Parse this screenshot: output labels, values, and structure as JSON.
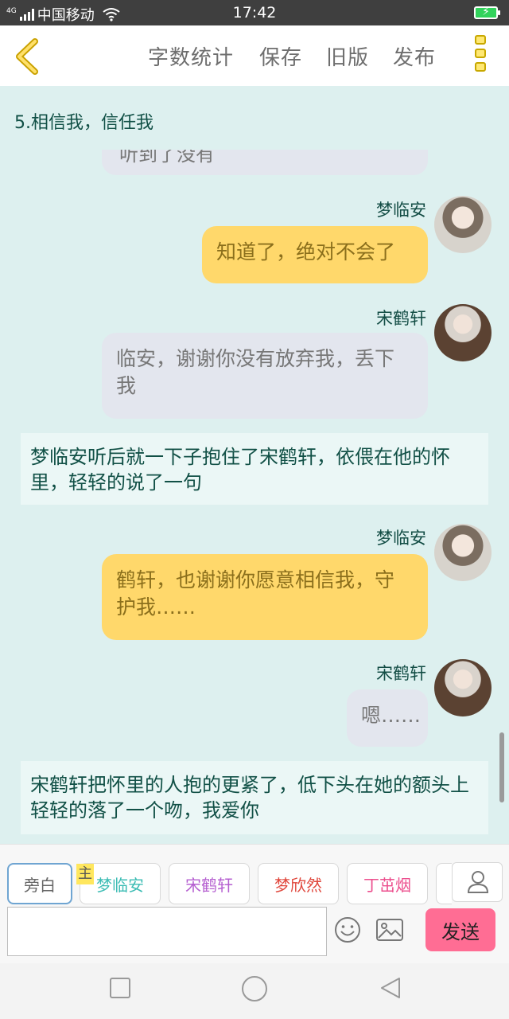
{
  "status": {
    "carrier": "中国移动",
    "network": "4G",
    "time": "17:42"
  },
  "header": {
    "back_icon": "chevron-left-icon",
    "buttons": [
      "字数统计",
      "保存",
      "旧版",
      "发布"
    ],
    "more_icon": "more-vertical-icon"
  },
  "chat": {
    "chapter_title": "5.相信我，信任我",
    "cut_text": "听到了没有",
    "messages": [
      {
        "speaker": "梦临安",
        "text": "知道了，绝对不会了"
      },
      {
        "speaker": "宋鹤轩",
        "text": "临安，谢谢你没有放弃我，丢下我"
      },
      {
        "narration": "梦临安听后就一下子抱住了宋鹤轩，依偎在他的怀里，轻轻的说了一句"
      },
      {
        "speaker": "梦临安",
        "text": "鹤轩，也谢谢你愿意相信我，守护我……"
      },
      {
        "speaker": "宋鹤轩",
        "text": "嗯……"
      },
      {
        "narration": "宋鹤轩把怀里的人抱的更紧了，低下头在她的额头上轻轻的落了一个吻，我爱你"
      }
    ]
  },
  "roles": {
    "items": [
      "旁白",
      "梦临安",
      "宋鹤轩",
      "梦欣然",
      "丁茁烟"
    ],
    "colors": [
      "#666666",
      "#3cbcb4",
      "#b55fd0",
      "#e0473c",
      "#ec4f8e"
    ],
    "main_tag": "主"
  },
  "input": {
    "value": "",
    "placeholder": ""
  },
  "send_label": "发送",
  "colors": {
    "background": "#ddf0ef",
    "bubble_yellow": "#ffd86b",
    "bubble_gray": "#e3e6ee",
    "send": "#ff6d94"
  }
}
